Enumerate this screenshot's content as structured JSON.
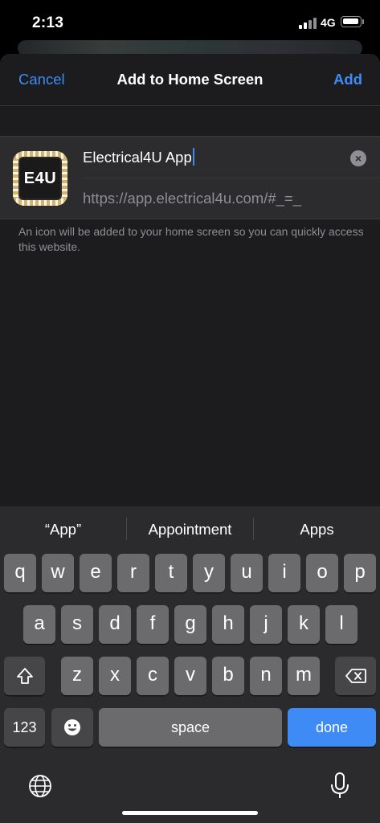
{
  "status": {
    "time": "2:13",
    "network": "4G"
  },
  "nav": {
    "cancel": "Cancel",
    "title": "Add to Home Screen",
    "add": "Add"
  },
  "app": {
    "icon_text": "E4U",
    "name_value": "Electrical4U App",
    "url": "https://app.electrical4u.com/#_=_",
    "hint": "An icon will be added to your home screen so you can quickly access this website."
  },
  "suggestions": [
    "“App”",
    "Appointment",
    "Apps"
  ],
  "keys": {
    "row1": [
      "q",
      "w",
      "e",
      "r",
      "t",
      "y",
      "u",
      "i",
      "o",
      "p"
    ],
    "row2": [
      "a",
      "s",
      "d",
      "f",
      "g",
      "h",
      "j",
      "k",
      "l"
    ],
    "row3": [
      "z",
      "x",
      "c",
      "v",
      "b",
      "n",
      "m"
    ],
    "numbers": "123",
    "space": "space",
    "done": "done"
  },
  "colors": {
    "accent": "#3e8bf6",
    "sheet": "#1c1c1e",
    "card": "#2c2c2e"
  },
  "icons": [
    "signal-icon",
    "battery-icon",
    "clear-icon",
    "shift-icon",
    "backspace-icon",
    "emoji-icon",
    "globe-icon",
    "microphone-icon"
  ]
}
